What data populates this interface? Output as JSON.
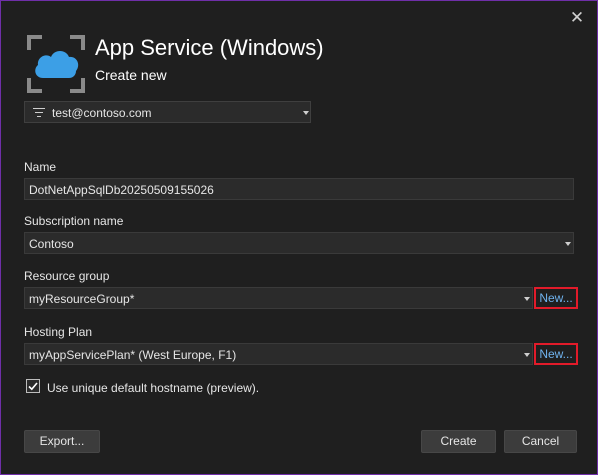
{
  "header": {
    "title": "App Service (Windows)",
    "subtitle": "Create new"
  },
  "account": {
    "email": "test@contoso.com"
  },
  "form": {
    "name": {
      "label": "Name",
      "value": "DotNetAppSqlDb20250509155026"
    },
    "subscription": {
      "label": "Subscription name",
      "value": "Contoso"
    },
    "resource_group": {
      "label": "Resource group",
      "value": "myResourceGroup*",
      "new_label": "New..."
    },
    "hosting_plan": {
      "label": "Hosting Plan",
      "value": "myAppServicePlan* (West Europe, F1)",
      "new_label": "New..."
    },
    "unique_hostname": {
      "label": "Use unique default hostname (preview).",
      "checked": true
    }
  },
  "buttons": {
    "export": "Export...",
    "create": "Create",
    "cancel": "Cancel"
  },
  "icons": {
    "close": "close-icon",
    "logo": "app-service-icon",
    "filter": "filter-icon",
    "dropdown": "chevron-down-icon",
    "check": "checkmark-icon"
  },
  "colors": {
    "accent_cloud": "#3c9fe6",
    "highlight_border": "#e21b2a",
    "link": "#6fb2ee",
    "window_border": "#6f2fa8"
  }
}
